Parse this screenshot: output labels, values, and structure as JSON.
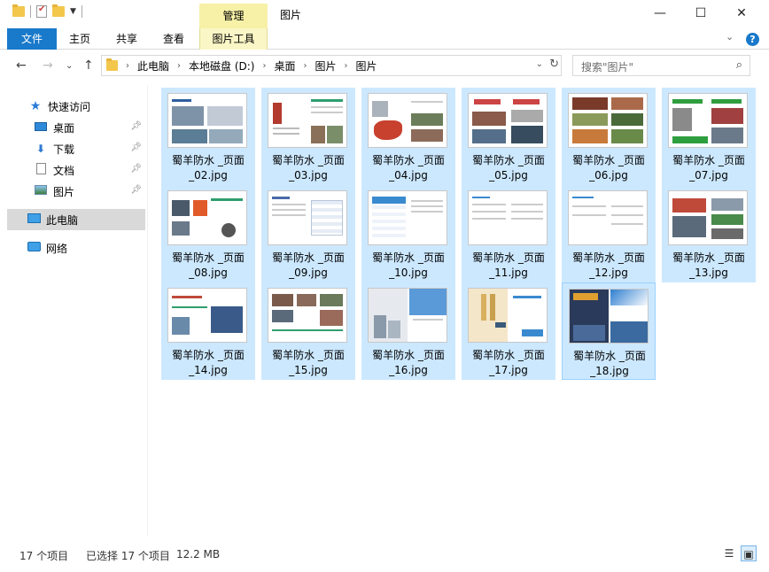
{
  "window": {
    "title": "图片",
    "manage_label": "管理",
    "minimize": "—",
    "maximize": "☐",
    "close": "✕"
  },
  "ribbon": {
    "tabs": [
      "文件",
      "主页",
      "共享",
      "查看",
      "图片工具"
    ]
  },
  "address": {
    "crumbs": [
      "此电脑",
      "本地磁盘 (D:)",
      "桌面",
      "图片",
      "图片"
    ],
    "search_placeholder": "搜索\"图片\""
  },
  "navpane": {
    "quick_access": "快速访问",
    "desktop": "桌面",
    "downloads": "下载",
    "documents": "文档",
    "pictures": "图片",
    "this_pc": "此电脑",
    "network": "网络"
  },
  "files": [
    {
      "name": "蜀羊防水 _页面_02.jpg",
      "line1": "蜀羊防水 _页面",
      "line2": "_02.jpg"
    },
    {
      "name": "蜀羊防水 _页面_03.jpg",
      "line1": "蜀羊防水 _页面",
      "line2": "_03.jpg"
    },
    {
      "name": "蜀羊防水 _页面_04.jpg",
      "line1": "蜀羊防水 _页面",
      "line2": "_04.jpg"
    },
    {
      "name": "蜀羊防水 _页面_05.jpg",
      "line1": "蜀羊防水 _页面",
      "line2": "_05.jpg"
    },
    {
      "name": "蜀羊防水 _页面_06.jpg",
      "line1": "蜀羊防水 _页面",
      "line2": "_06.jpg"
    },
    {
      "name": "蜀羊防水 _页面_07.jpg",
      "line1": "蜀羊防水 _页面",
      "line2": "_07.jpg"
    },
    {
      "name": "蜀羊防水 _页面_08.jpg",
      "line1": "蜀羊防水 _页面",
      "line2": "_08.jpg"
    },
    {
      "name": "蜀羊防水 _页面_09.jpg",
      "line1": "蜀羊防水 _页面",
      "line2": "_09.jpg"
    },
    {
      "name": "蜀羊防水 _页面_10.jpg",
      "line1": "蜀羊防水 _页面",
      "line2": "_10.jpg"
    },
    {
      "name": "蜀羊防水 _页面_11.jpg",
      "line1": "蜀羊防水 _页面",
      "line2": "_11.jpg"
    },
    {
      "name": "蜀羊防水 _页面_12.jpg",
      "line1": "蜀羊防水 _页面",
      "line2": "_12.jpg"
    },
    {
      "name": "蜀羊防水 _页面_13.jpg",
      "line1": "蜀羊防水 _页面",
      "line2": "_13.jpg"
    },
    {
      "name": "蜀羊防水 _页面_14.jpg",
      "line1": "蜀羊防水 _页面",
      "line2": "_14.jpg"
    },
    {
      "name": "蜀羊防水 _页面_15.jpg",
      "line1": "蜀羊防水 _页面",
      "line2": "_15.jpg"
    },
    {
      "name": "蜀羊防水 _页面_16.jpg",
      "line1": "蜀羊防水 _页面",
      "line2": "_16.jpg"
    },
    {
      "name": "蜀羊防水 _页面_17.jpg",
      "line1": "蜀羊防水 _页面",
      "line2": "_17.jpg"
    },
    {
      "name": "蜀羊防水 _页面_18.jpg",
      "line1": "蜀羊防水 _页面",
      "line2": "_18.jpg"
    }
  ],
  "status": {
    "item_count": "17 个项目",
    "selection": "已选择 17 个项目",
    "size": "12.2 MB"
  },
  "colors": {
    "accent": "#1979ca",
    "selection": "#cce8ff",
    "manage_tab": "#f7f1a8"
  }
}
